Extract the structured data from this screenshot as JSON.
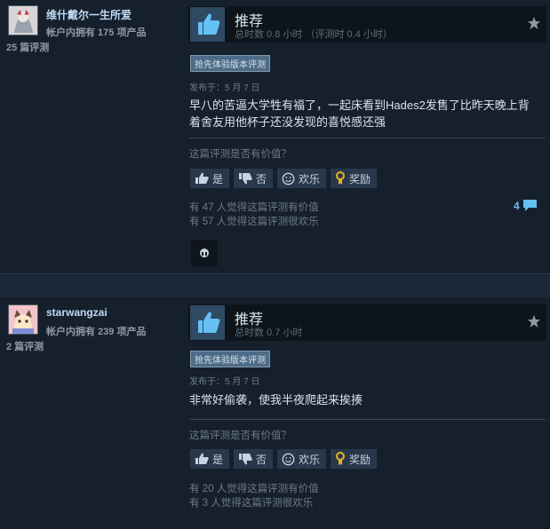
{
  "reviews": [
    {
      "author": {
        "name": "维什戴尔一生所爱",
        "products": "帐户内拥有 175 项产品",
        "review_count": "25 篇评测"
      },
      "verdict": "推荐",
      "hours": "总时数 0.8 小时  （评测时 0.4 小时）",
      "badge": "抢先体验版本评测",
      "posted": "发布于：5 月 7 日",
      "text": "早八的苦逼大学牲有福了，一起床看到Hades2发售了比昨天晚上背着舍友用他杯子还没发现的喜悦感还强",
      "helpful_question": "这篇评测是否有价值？",
      "buttons": {
        "yes": "是",
        "no": "否",
        "funny": "欢乐",
        "award": "奖励"
      },
      "helpful_count": "有 47 人觉得这篇评测有价值",
      "funny_count": "有 57 人觉得这篇评测很欢乐",
      "comments": "4"
    },
    {
      "author": {
        "name": "starwangzai",
        "products": "帐户内拥有 239 项产品",
        "review_count": "2 篇评测"
      },
      "verdict": "推荐",
      "hours": "总时数 0.7 小时",
      "badge": "抢先体验版本评测",
      "posted": "发布于：5 月 7 日",
      "text": "非常好偷袭，使我半夜爬起来挨揍",
      "helpful_question": "这篇评测是否有价值？",
      "buttons": {
        "yes": "是",
        "no": "否",
        "funny": "欢乐",
        "award": "奖励"
      },
      "helpful_count": "有 20 人觉得这篇评测有价值",
      "funny_count": "有 3 人觉得这篇评测很欢乐"
    }
  ],
  "colors": {
    "accent_link": "#66c0f4",
    "username": "#c1dbf4",
    "thumb_up": "#66c0f4",
    "award": "#e4b322"
  }
}
